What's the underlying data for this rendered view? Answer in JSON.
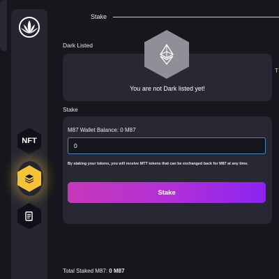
{
  "nav": {
    "logo_icon": "leaf-logo-icon",
    "items": [
      {
        "label": "NFT",
        "icon": "nft-text-icon"
      },
      {
        "label": "",
        "icon": "layers-stack-icon",
        "active": true
      },
      {
        "label": "",
        "icon": "document-list-icon"
      }
    ]
  },
  "page": {
    "title": "Stake"
  },
  "dark_listed": {
    "section_label": "Dark Listed",
    "badge_icon": "ethereum-diamond-icon",
    "message": "You are not Dark listed yet!"
  },
  "right_panel": {
    "label_partial": "T"
  },
  "stake": {
    "section_label": "Stake",
    "balance_label": "M87 Wallet Balance: 0 M87",
    "amount_value": "0",
    "info_text": "By staking your tokens, you will receive MTT tokens that can be exchanged back for M87 at any time.",
    "button_label": "Stake"
  },
  "footer": {
    "total_label": "Total Staked M87:",
    "total_value": "0 M87"
  },
  "colors": {
    "accent_yellow": "#f5c338",
    "gradient_start": "#c638b9",
    "gradient_end": "#8a24f0",
    "card_bg": "#272834",
    "page_bg": "#16161d"
  }
}
